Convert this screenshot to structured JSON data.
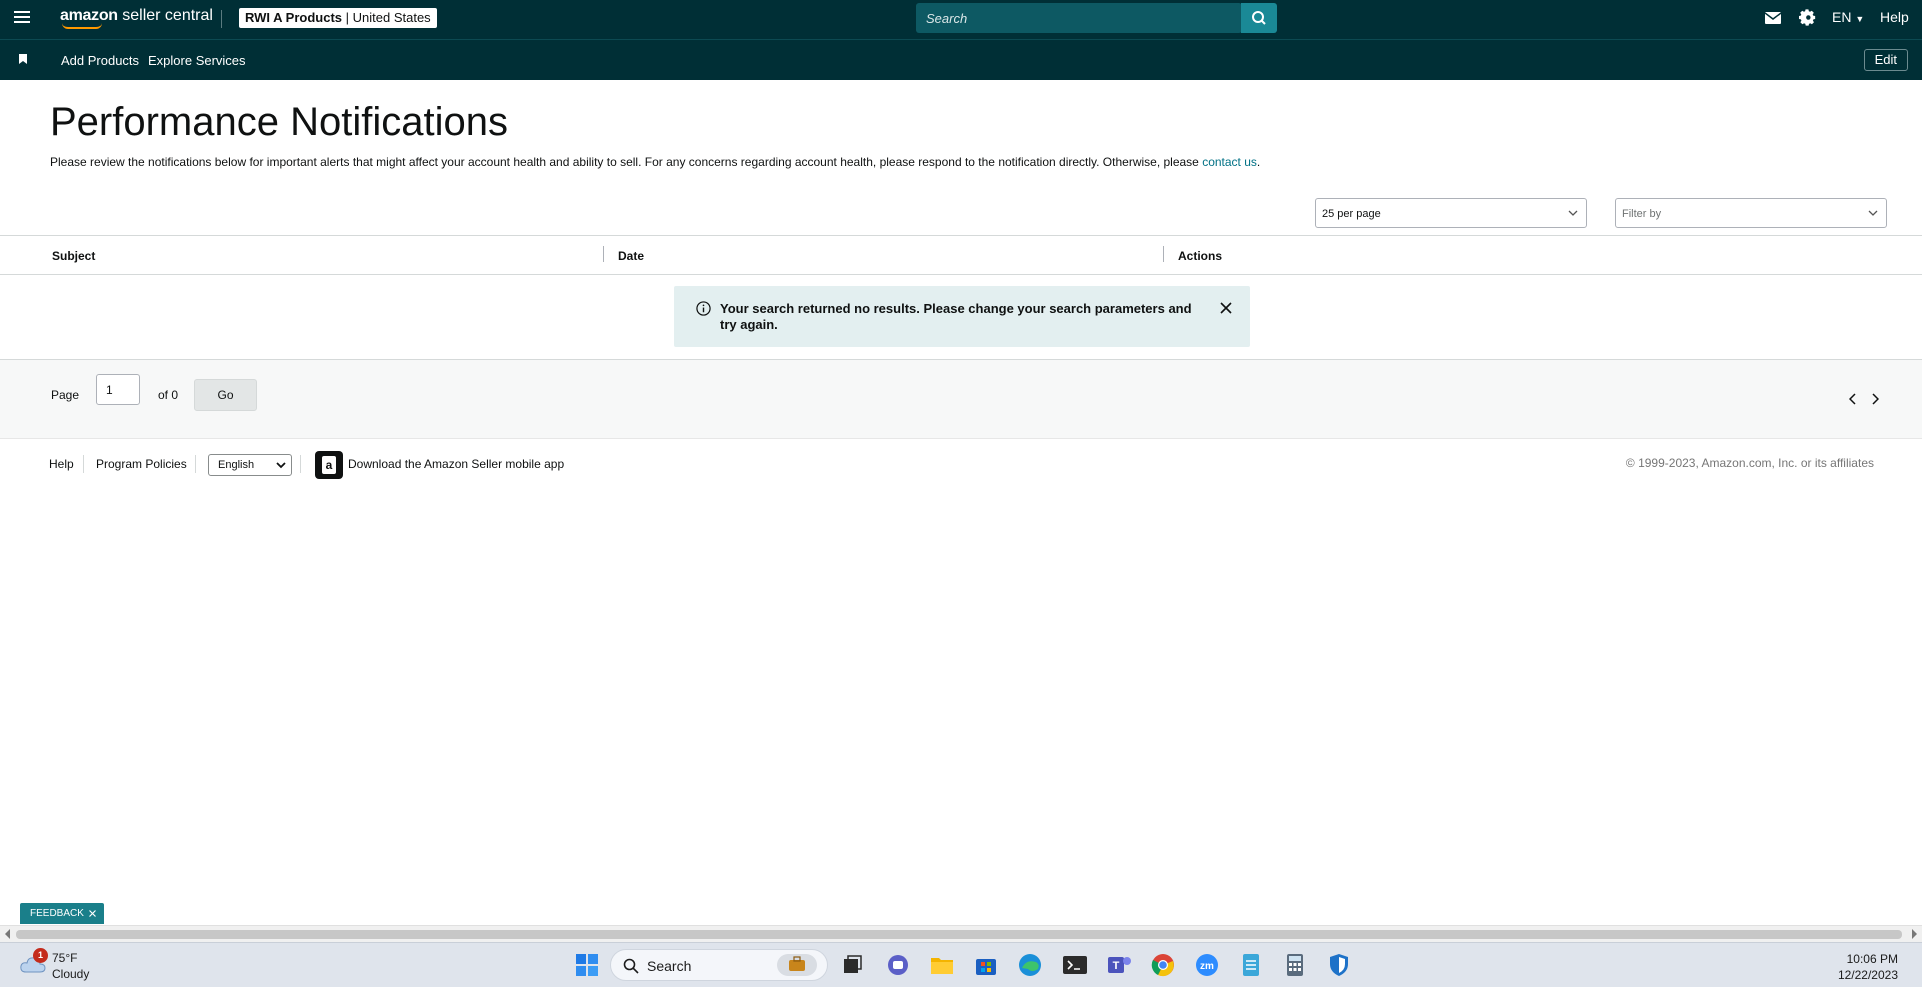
{
  "header": {
    "logo_brand": "amazon",
    "logo_product": "seller central",
    "account_name": "RWI A Products",
    "account_region": "United States",
    "search_placeholder": "Search",
    "language": "EN",
    "help": "Help"
  },
  "nav": {
    "items": [
      "Add Products",
      "Explore Services"
    ],
    "edit": "Edit"
  },
  "page": {
    "title": "Performance Notifications",
    "description": "Please review the notifications below for important alerts that might affect your account health and ability to sell. For any concerns regarding account health, please respond to the notification directly. Otherwise, please ",
    "contact_link": "contact us",
    "description_end": "."
  },
  "controls": {
    "per_page": "25 per page",
    "filter_placeholder": "Filter by"
  },
  "table": {
    "columns": [
      "Subject",
      "Date",
      "Actions"
    ],
    "empty_message": "Your search returned no results. Please change your search parameters and try again."
  },
  "pagination": {
    "page_label": "Page",
    "page_value": "1",
    "of_label": "of 0",
    "go": "Go"
  },
  "footer": {
    "help": "Help",
    "program_policies": "Program Policies",
    "language": "English",
    "download_app": "Download the Amazon Seller mobile app",
    "copyright": "© 1999-2023, Amazon.com, Inc. or its affiliates"
  },
  "feedback": "FEEDBACK",
  "taskbar": {
    "weather_badge": "1",
    "temperature": "75°F",
    "condition": "Cloudy",
    "search": "Search",
    "time": "10:06 PM",
    "date": "12/22/2023",
    "apps": [
      "start-icon",
      "work-icon",
      "task-view-icon",
      "chat-icon",
      "file-explorer-icon",
      "store-icon",
      "edge-icon",
      "terminal-icon",
      "teams-icon",
      "chrome-icon",
      "zoom-icon",
      "notepad-icon",
      "calculator-icon",
      "defender-icon"
    ]
  },
  "colors": {
    "header_bg": "#002f36",
    "search_button": "#1a8996",
    "link": "#007185",
    "alert_bg": "#e3eff0",
    "feedback_bg": "#1a7f8a"
  }
}
